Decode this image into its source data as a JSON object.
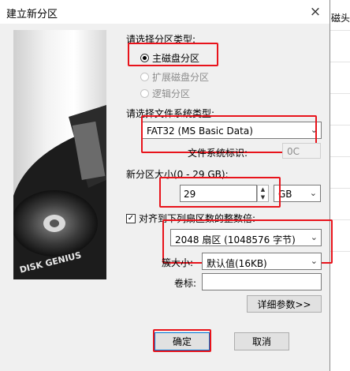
{
  "window": {
    "title": "建立新分区",
    "close_icon": "×"
  },
  "background": {
    "partial_label": "磁头"
  },
  "image_panel": {
    "brand": "DISK GENIUS"
  },
  "partition_type": {
    "label": "请选择分区类型:",
    "options": [
      {
        "label": "主磁盘分区",
        "selected": true,
        "enabled": true
      },
      {
        "label": "扩展磁盘分区",
        "selected": false,
        "enabled": false
      },
      {
        "label": "逻辑分区",
        "selected": false,
        "enabled": false
      }
    ]
  },
  "filesystem": {
    "label": "请选择文件系统类型:",
    "value": "FAT32 (MS Basic Data)",
    "id_label": "文件系统标识:",
    "id_value": "0C"
  },
  "size": {
    "label": "新分区大小(0 - 29 GB):",
    "value": "29",
    "unit": "GB"
  },
  "align": {
    "checked": true,
    "label": "对齐到下列扇区数的整数倍:",
    "value": "2048 扇区 (1048576 字节)"
  },
  "cluster": {
    "label": "簇大小:",
    "value": "默认值(16KB)"
  },
  "volume": {
    "label": "卷标:",
    "value": ""
  },
  "details_button": "详细参数>>",
  "ok_button": "确定",
  "cancel_button": "取消",
  "colors": {
    "highlight": "#e8131b",
    "dialog_bg": "#f0f0f0"
  }
}
